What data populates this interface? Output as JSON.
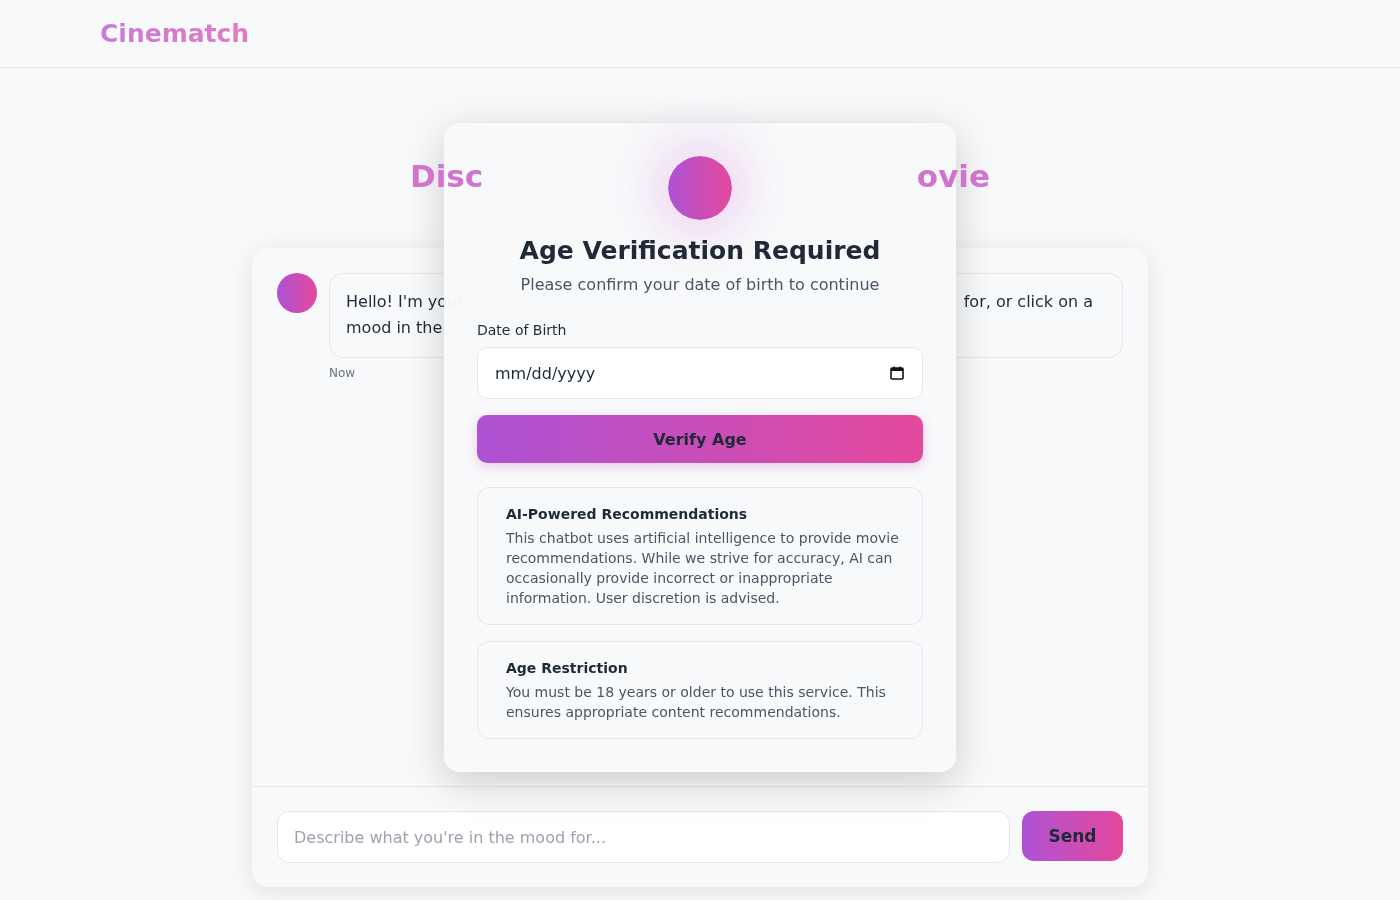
{
  "header": {
    "logo": "Cinematch"
  },
  "hero": {
    "title_left": "Disc",
    "title_right": "ovie"
  },
  "chat": {
    "messages": [
      {
        "line_left": "Hello! I'm your",
        "line_right": "for, or click on a",
        "line_2": "mood in the",
        "time": "Now"
      }
    ],
    "input": {
      "placeholder": "Describe what you're in the mood for..."
    },
    "send_button": "Send"
  },
  "modal": {
    "title": "Age Verification Required",
    "subtitle": "Please confirm your date of birth to continue",
    "field_label": "Date of Birth",
    "date_field": {
      "placeholder": "mm/dd/yyyy"
    },
    "verify_button": "Verify Age",
    "notices": [
      {
        "title": "AI-Powered Recommendations",
        "text": "This chatbot uses artificial intelligence to provide movie recommendations. While we strive for accuracy, AI can occasionally provide incorrect or inappropriate information. User discretion is advised."
      },
      {
        "title": "Age Restriction",
        "text": "You must be 18 years or older to use this service. This ensures appropriate content recommendations."
      }
    ]
  }
}
